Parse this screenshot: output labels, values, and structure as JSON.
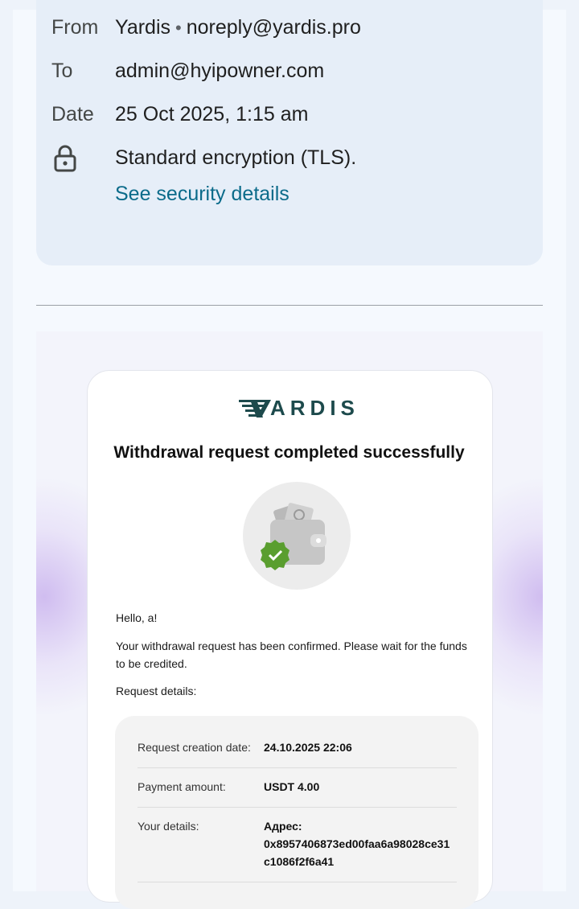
{
  "header": {
    "from_label": "From",
    "from_name": "Yardis",
    "from_separator": "•",
    "from_email": "noreply@yardis.pro",
    "to_label": "To",
    "to_email": "admin@hyipowner.com",
    "date_label": "Date",
    "date_value": "25 Oct 2025, 1:15 am",
    "encryption_text": "Standard encryption (TLS).",
    "security_link": "See security details",
    "lock_icon": "lock-icon"
  },
  "email": {
    "logo_text": "ARDIS",
    "title": "Withdrawal request completed successfully",
    "wallet_icon": "wallet-check-icon",
    "greeting": "Hello, a!",
    "body_line1": "Your withdrawal request has been confirmed. Please wait for the funds",
    "body_line2": "to be credited.",
    "details_heading": "Request details:",
    "details": [
      {
        "label": "Request creation date:",
        "value": "24.10.2025 22:06"
      },
      {
        "label": "Payment amount:",
        "value": "USDT 4.00"
      },
      {
        "label": "Your details:",
        "value_line1": "Адрес:",
        "value_line2": "0x8957406873ed00faa6a98028ce31",
        "value_line3": "c1086f2f6a41"
      }
    ]
  },
  "colors": {
    "link": "#0b6b8a",
    "logo": "#1d4a4c",
    "check_badge": "#5a9e2f"
  }
}
